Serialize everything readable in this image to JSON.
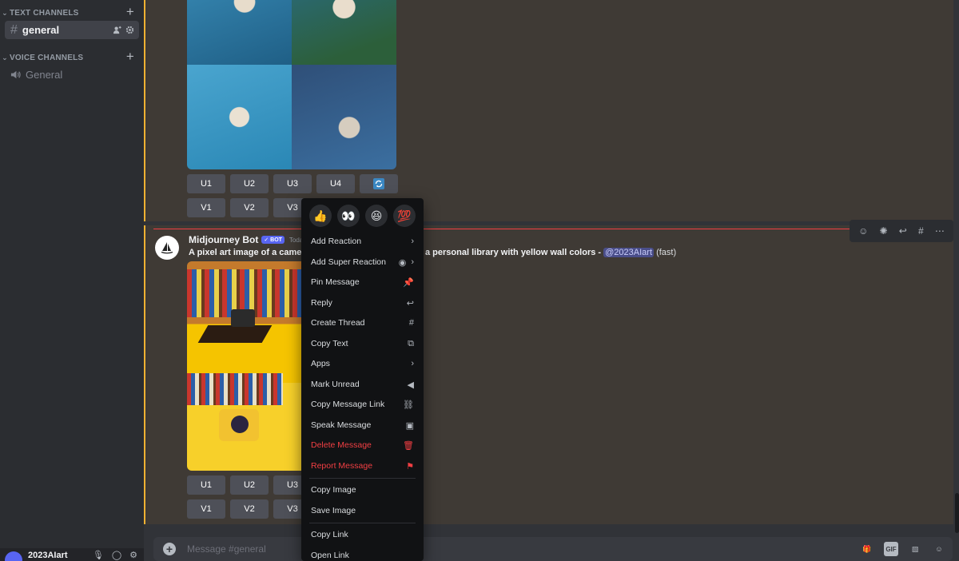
{
  "sidebar": {
    "text_channels_label": "TEXT CHANNELS",
    "voice_channels_label": "VOICE CHANNELS",
    "text_channel": "general",
    "voice_channel": "General",
    "username": "2023AIart"
  },
  "message1": {
    "upscale_buttons": [
      "U1",
      "U2",
      "U3",
      "U4"
    ],
    "variation_buttons": [
      "V1",
      "V2",
      "V3"
    ]
  },
  "message2": {
    "author": "Midjourney Bot",
    "bot_tag": "✓ BOT",
    "timestamp": "Today a",
    "prompt_visible_left": "A pixel art image of a came",
    "prompt_visible_right": "a personal library with yellow wall colors",
    "prompt_dash": " - ",
    "mention": "@2023AIart",
    "mode": " (fast)",
    "upscale_buttons": [
      "U1",
      "U2",
      "U3"
    ],
    "variation_buttons": [
      "V1",
      "V2",
      "V3"
    ]
  },
  "composer": {
    "placeholder": "Message #general",
    "gif_label": "GIF"
  },
  "context_menu": {
    "reactions": [
      "👍",
      "👀",
      "😆",
      "💯"
    ],
    "items": [
      {
        "label": "Add Reaction",
        "icon": "chevron-right-icon"
      },
      {
        "label": "Add Super Reaction",
        "icon": "super-reaction-icon"
      },
      {
        "label": "Pin Message",
        "icon": "pin-icon"
      },
      {
        "label": "Reply",
        "icon": "reply-icon"
      },
      {
        "label": "Create Thread",
        "icon": "thread-icon"
      },
      {
        "label": "Copy Text",
        "icon": "copy-icon"
      },
      {
        "label": "Apps",
        "icon": "chevron-right-icon"
      },
      {
        "label": "Mark Unread",
        "icon": "mark-unread-icon"
      },
      {
        "label": "Copy Message Link",
        "icon": "link-icon"
      },
      {
        "label": "Speak Message",
        "icon": "speak-icon"
      },
      {
        "label": "Delete Message",
        "icon": "trash-icon"
      },
      {
        "label": "Report Message",
        "icon": "flag-icon"
      },
      {
        "label": "Copy Image",
        "icon": ""
      },
      {
        "label": "Save Image",
        "icon": ""
      },
      {
        "label": "Copy Link",
        "icon": ""
      },
      {
        "label": "Open Link",
        "icon": ""
      }
    ]
  },
  "colors": {
    "accent": "#5865f2",
    "danger": "#f23f43",
    "highlight_border": "#f0b232"
  }
}
